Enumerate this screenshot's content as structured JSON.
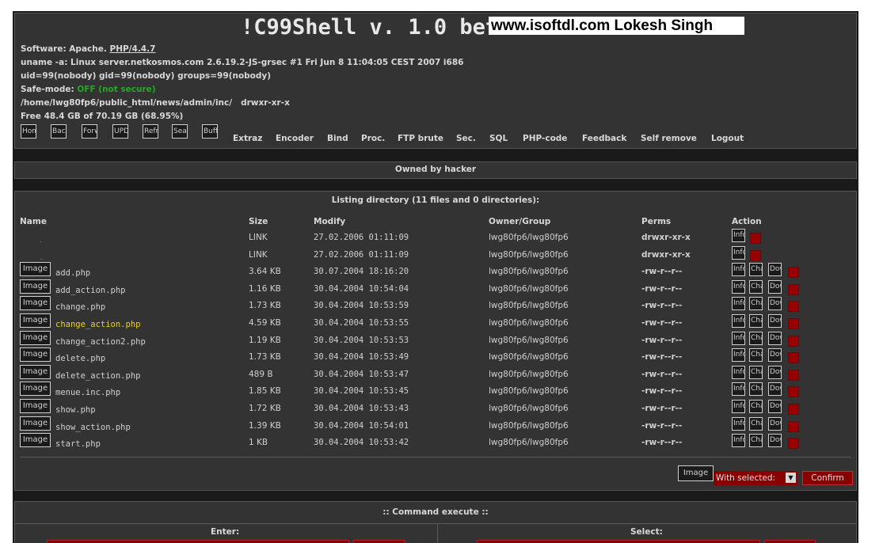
{
  "header": {
    "title": "!C99Shell v. 1.0 beta",
    "watermark": "www.isoftdl.com Lokesh Singh",
    "software_label": "Software: Apache.",
    "software_link": "PHP/4.4.7",
    "uname": "uname -a: Linux server.netkosmos.com 2.6.19.2-JS-grsec #1 Fri Jun 8 11:04:05 CEST 2007 i686",
    "uid": "uid=99(nobody) gid=99(nobody) groups=99(nobody)",
    "safe_mode_label": "Safe-mode:",
    "safe_mode_value": "OFF (not secure)",
    "path": "/home/lwg80fp6/public_html/news/admin/inc/",
    "path_perms": "drwxr-xr-x",
    "free": "Free 48.4 GB of 70.19 GB (68.95%)"
  },
  "toolbar": {
    "buttons": [
      "Home",
      "Back",
      "Forward",
      "UPDIR",
      "Refresh",
      "Search",
      "Buffer"
    ],
    "links": [
      "Extraz",
      "Encoder",
      "Bind",
      "Proc.",
      "FTP brute",
      "Sec.",
      "SQL",
      "PHP-code",
      "Feedback",
      "Self remove",
      "Logout"
    ]
  },
  "owned": "Owned by hacker",
  "listing": {
    "title": "Listing directory (11 files and 0 directories):",
    "columns": [
      "Name",
      "Size",
      "Modify",
      "Owner/Group",
      "Perms",
      "Action"
    ],
    "image_label": "Image",
    "action_labels": [
      "Info",
      "Change",
      "Download"
    ],
    "dirs": [
      {
        "name": ".",
        "size": "LINK",
        "modify": "27.02.2006 01:11:09",
        "owner": "lwg80fp6/lwg80fp6",
        "perms": "drwxr-xr-x"
      },
      {
        "name": "..",
        "size": "LINK",
        "modify": "27.02.2006 01:11:09",
        "owner": "lwg80fp6/lwg80fp6",
        "perms": "drwxr-xr-x"
      }
    ],
    "files": [
      {
        "name": "add.php",
        "size": "3.64 KB",
        "modify": "30.07.2004 18:16:20",
        "owner": "lwg80fp6/lwg80fp6",
        "perms": "-rw-r--r--"
      },
      {
        "name": "add_action.php",
        "size": "1.16 KB",
        "modify": "30.04.2004 10:54:04",
        "owner": "lwg80fp6/lwg80fp6",
        "perms": "-rw-r--r--"
      },
      {
        "name": "change.php",
        "size": "1.73 KB",
        "modify": "30.04.2004 10:53:59",
        "owner": "lwg80fp6/lwg80fp6",
        "perms": "-rw-r--r--"
      },
      {
        "name": "change_action.php",
        "size": "4.59 KB",
        "modify": "30.04.2004 10:53:55",
        "owner": "lwg80fp6/lwg80fp6",
        "perms": "-rw-r--r--"
      },
      {
        "name": "change_action2.php",
        "size": "1.19 KB",
        "modify": "30.04.2004 10:53:53",
        "owner": "lwg80fp6/lwg80fp6",
        "perms": "-rw-r--r--"
      },
      {
        "name": "delete.php",
        "size": "1.73 KB",
        "modify": "30.04.2004 10:53:49",
        "owner": "lwg80fp6/lwg80fp6",
        "perms": "-rw-r--r--"
      },
      {
        "name": "delete_action.php",
        "size": "489 B",
        "modify": "30.04.2004 10:53:47",
        "owner": "lwg80fp6/lwg80fp6",
        "perms": "-rw-r--r--"
      },
      {
        "name": "menue.inc.php",
        "size": "1.85 KB",
        "modify": "30.04.2004 10:53:45",
        "owner": "lwg80fp6/lwg80fp6",
        "perms": "-rw-r--r--"
      },
      {
        "name": "show.php",
        "size": "1.72 KB",
        "modify": "30.04.2004 10:53:43",
        "owner": "lwg80fp6/lwg80fp6",
        "perms": "-rw-r--r--"
      },
      {
        "name": "show_action.php",
        "size": "1.39 KB",
        "modify": "30.04.2004 10:54:01",
        "owner": "lwg80fp6/lwg80fp6",
        "perms": "-rw-r--r--"
      },
      {
        "name": "start.php",
        "size": "1 KB",
        "modify": "30.04.2004 10:53:42",
        "owner": "lwg80fp6/lwg80fp6",
        "perms": "-rw-r--r--"
      }
    ],
    "highlighted_file": "change_action.php",
    "bottom_image_label": "Image",
    "with_selected": "With selected:",
    "confirm": "Confirm"
  },
  "command": {
    "title": ":: Command execute ::",
    "enter": "Enter:",
    "select": "Select:"
  },
  "colors": {
    "panel": "#333333",
    "accent_red": "#880000",
    "highlight": "#e6d12a",
    "safe_mode": "#22aa22"
  }
}
